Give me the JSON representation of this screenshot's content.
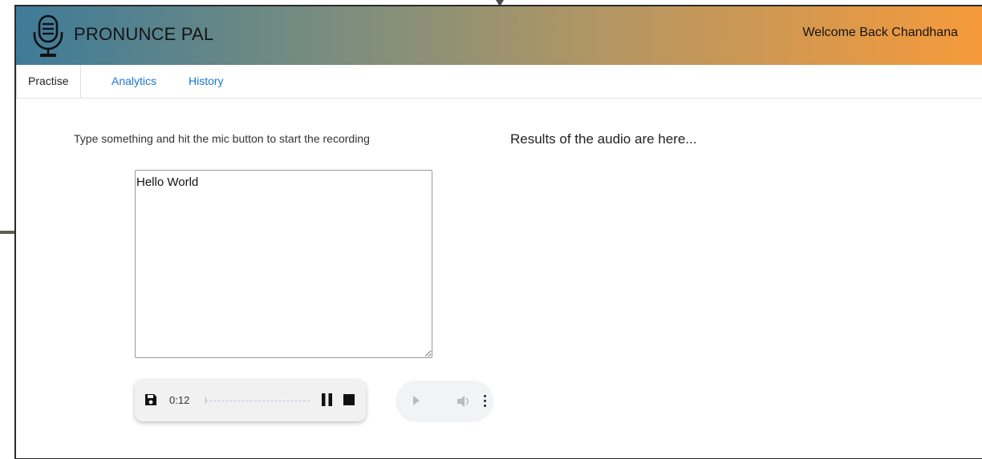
{
  "header": {
    "app_title": "PRONUNCE PAL",
    "welcome_text": "Welcome Back Chandhana",
    "logo_icon": "microphone-icon",
    "gradient_colors": [
      "#3e7b98",
      "#7e8e7d",
      "#b19664",
      "#f69a3b"
    ]
  },
  "tabs": [
    {
      "label": "Practise",
      "active": true
    },
    {
      "label": "Analytics",
      "active": false
    },
    {
      "label": "History",
      "active": false
    }
  ],
  "practice": {
    "instructions": "Type something and hit the mic button to start the recording",
    "text_value": "Hello World"
  },
  "results": {
    "heading": "Results of the audio are here..."
  },
  "recorder": {
    "save_icon": "save-icon",
    "elapsed": "0:12",
    "pause_icon": "pause-icon",
    "stop_icon": "stop-icon"
  },
  "player": {
    "play_icon": "play-icon",
    "volume_icon": "volume-icon",
    "more_icon": "more-vertical-icon"
  }
}
